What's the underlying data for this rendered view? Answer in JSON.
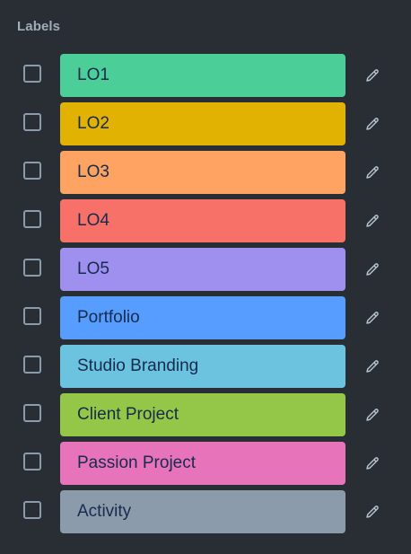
{
  "panel": {
    "heading": "Labels"
  },
  "labels": [
    {
      "name": "LO1",
      "color": "#4bce97",
      "checked": false
    },
    {
      "name": "LO2",
      "color": "#e2b203",
      "checked": false
    },
    {
      "name": "LO3",
      "color": "#fea362",
      "checked": false
    },
    {
      "name": "LO4",
      "color": "#f87168",
      "checked": false
    },
    {
      "name": "LO5",
      "color": "#9f8fef",
      "checked": false
    },
    {
      "name": "Portfolio",
      "color": "#579dff",
      "checked": false
    },
    {
      "name": "Studio Branding",
      "color": "#6cc3e0",
      "checked": false
    },
    {
      "name": "Client Project",
      "color": "#94c748",
      "checked": false
    },
    {
      "name": "Passion Project",
      "color": "#e774bb",
      "checked": false
    },
    {
      "name": "Activity",
      "color": "#8c9bab",
      "checked": false
    }
  ],
  "icons": {
    "edit": "pencil-icon"
  }
}
